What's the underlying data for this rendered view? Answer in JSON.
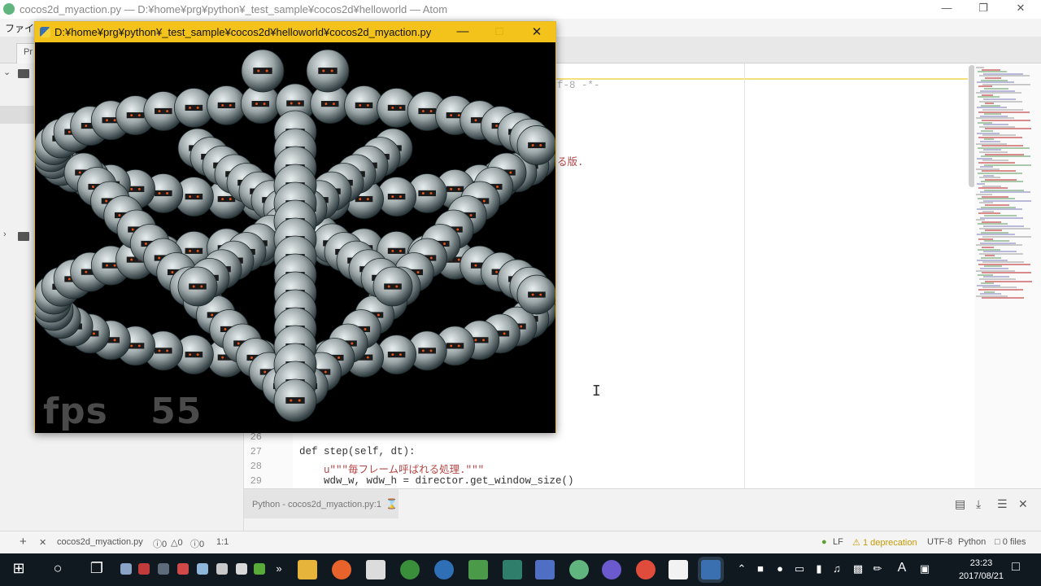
{
  "atom": {
    "title": "cocos2d_myaction.py — D:¥home¥prg¥python¥_test_sample¥cocos2d¥helloworld — Atom",
    "menu_file": "ファイル",
    "tree_tab": "Pr",
    "accent": "#f4e07a"
  },
  "editor": {
    "visible_fragments": {
      "coding": "f-8 -*-",
      "docstring_tail": "る版."
    },
    "lines": [
      {
        "num": "26",
        "text": ""
      },
      {
        "num": "27",
        "text": "    def step(self, dt):"
      },
      {
        "num": "28",
        "text": "        u\"\"\"毎フレーム呼ばれる処理.\"\"\""
      },
      {
        "num": "29",
        "text": "        wdw_w, wdw_h = director.get_window_size()"
      }
    ]
  },
  "panel": {
    "title": "Python - cocos2d_myaction.py:1"
  },
  "status": {
    "file": "cocos2d_myaction.py",
    "errors": "0",
    "warnings": "0",
    "infos": "0",
    "position": "1:1",
    "line_ending": "LF",
    "deprecation": "1 deprecation",
    "encoding": "UTF-8",
    "grammar": "Python",
    "files": "0 files"
  },
  "game": {
    "title": "D:¥home¥prg¥python¥_test_sample¥cocos2d¥helloworld¥cocos2d_myaction.py",
    "fps_label": "fps",
    "fps_value": "55",
    "titlebar_color": "#f3c21b"
  },
  "taskbar": {
    "time": "23:23",
    "date": "2017/08/21"
  }
}
